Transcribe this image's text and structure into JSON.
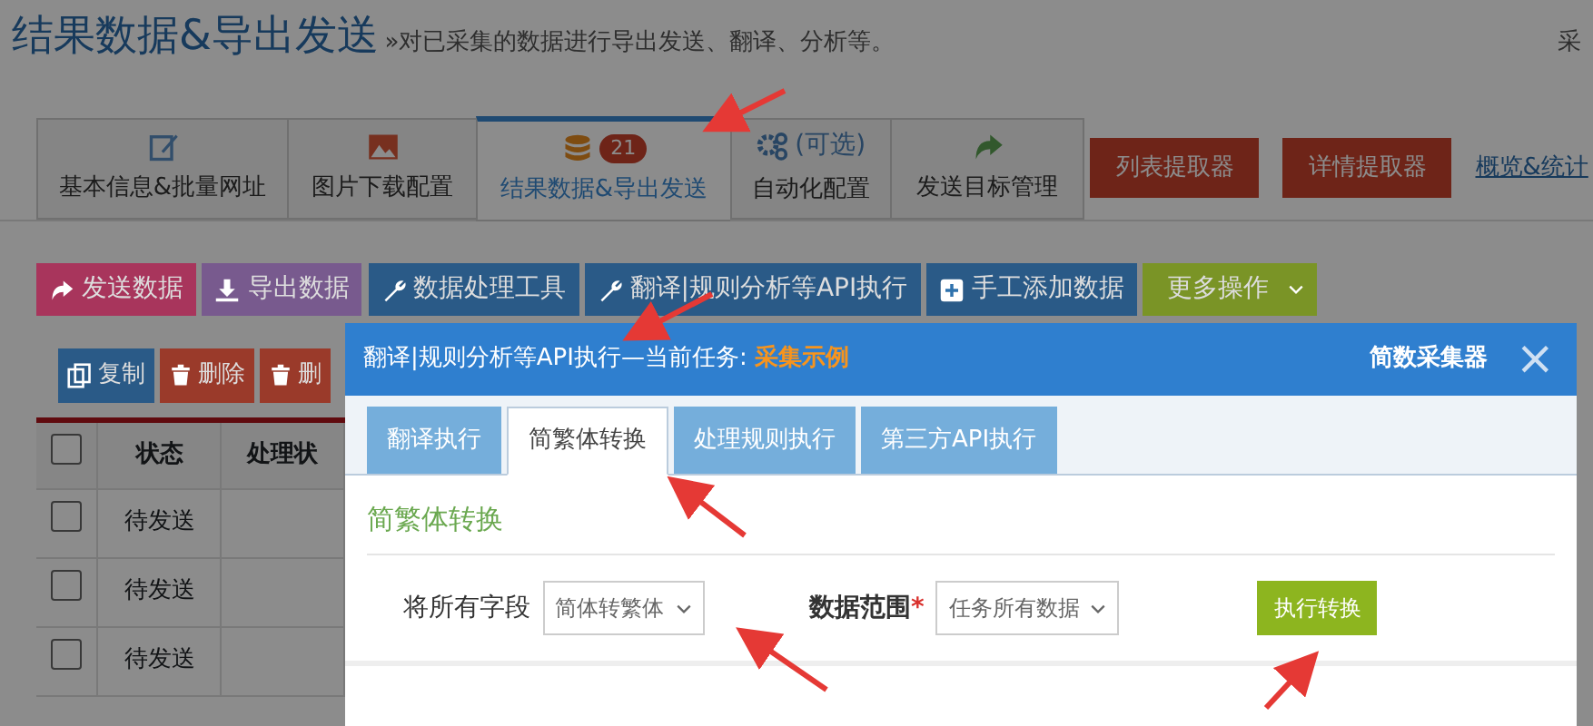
{
  "page_title": "结果数据&导出发送",
  "page_subtitle": "»对已采集的数据进行导出发送、翻译、分析等。",
  "header_edge_text": "采",
  "tabs": [
    {
      "label": "基本信息&批量网址",
      "selected": false
    },
    {
      "label": "图片下载配置",
      "selected": false
    },
    {
      "label": "结果数据&导出发送",
      "badge": "21",
      "selected": true
    },
    {
      "label": "自动化配置",
      "icon_text": "(可选)",
      "selected": false
    },
    {
      "label": "发送目标管理",
      "selected": false
    }
  ],
  "extractor_buttons": [
    "列表提取器",
    "详情提取器"
  ],
  "overview_link": "概览&统计",
  "toolbar": [
    {
      "label": "发送数据",
      "color": "#a8355c",
      "kind": "button"
    },
    {
      "label": "导出数据",
      "color": "#785a8e",
      "kind": "button"
    },
    {
      "label": "数据处理工具",
      "color": "#2a5a87",
      "kind": "button"
    },
    {
      "label": "翻译|规则分析等API执行",
      "color": "#2a5a87",
      "kind": "button"
    },
    {
      "label": "手工添加数据",
      "color": "#2a5a87",
      "kind": "button"
    },
    {
      "label": "更多操作",
      "color": "#7a9426",
      "kind": "dropdown"
    }
  ],
  "row_actions": [
    {
      "label": "复制",
      "color": "#2a5a87"
    },
    {
      "label": "删除",
      "color": "#9a3a2a"
    },
    {
      "label": "删",
      "color": "#9a3a2a"
    }
  ],
  "table": {
    "header_checked": false,
    "columns": [
      "状态",
      "处理状"
    ],
    "rows": [
      {
        "checked": false,
        "status": "待发送"
      },
      {
        "checked": false,
        "status": "待发送"
      },
      {
        "checked": false,
        "status": "待发送"
      }
    ]
  },
  "modal": {
    "title": "翻译|规则分析等API执行—当前任务: ",
    "task_name": "采集示例",
    "brand": "简数采集器",
    "close": "×",
    "tabs": [
      {
        "label": "翻译执行",
        "selected": false
      },
      {
        "label": "简繁体转换",
        "selected": true
      },
      {
        "label": "处理规则执行",
        "selected": false
      },
      {
        "label": "第三方API执行",
        "selected": false
      }
    ],
    "section_title": "简繁体转换",
    "required_marker": "*",
    "fields": [
      {
        "label": "将所有字段",
        "required": false,
        "value": "简体转繁体"
      },
      {
        "label": "数据范围",
        "required": true,
        "value": "任务所有数据"
      }
    ],
    "action_button": "执行转换"
  }
}
